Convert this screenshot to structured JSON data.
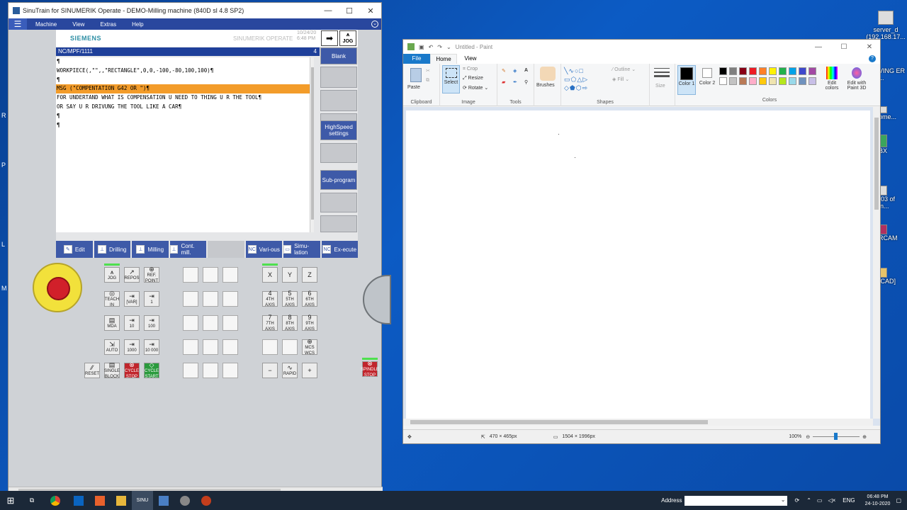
{
  "sinutrain": {
    "title": "SinuTrain for SINUMERIK Operate - DEMO-Milling machine (840D sl 4.8 SP2)",
    "menu": [
      "Machine",
      "View",
      "Extras",
      "Help"
    ],
    "brand": "SIEMENS",
    "product": "SINUMERIK OPERATE",
    "date": "10/24/20",
    "time": "6:48 PM",
    "jog_label": "JOG",
    "program_path": "NC/MPF/1111",
    "channel_num": "4",
    "lines": [
      "¶",
      "WORKPIECE(,\"\",,\"RECTANGLE\",0,0,-100,-80,100,100)¶",
      "¶",
      "MSG (\"COMPENTATION G42 OR \")¶",
      "FOR UNDERTAND WHAT IS COMPENSATION U NEED TO THING U R THE TOOL¶",
      "OR SAY U R DRIVUNG THE TOOL LIKE A CAR¶",
      "¶",
      "¶"
    ],
    "highlight_line": 3,
    "vsoftkeys": [
      "Blank",
      "",
      "",
      "",
      "HighSpeed settings",
      "",
      "Sub-program",
      "",
      ""
    ],
    "hsoftkeys": [
      {
        "label": "Edit",
        "icon": "edit-icon"
      },
      {
        "label": "Drilling",
        "icon": "drill-icon"
      },
      {
        "label": "Milling",
        "icon": "mill-icon"
      },
      {
        "label": "Cont. mill.",
        "icon": "contour-icon"
      },
      {
        "label": "",
        "icon": ""
      },
      {
        "label": "Vari-ous",
        "icon": "nc-icon"
      },
      {
        "label": "Simu-lation",
        "icon": "sim-icon"
      },
      {
        "label": "Ex-ecute",
        "icon": "nc-exec-icon"
      }
    ],
    "panel_keys": {
      "jog": "JOG",
      "repos": "REPOS",
      "refpoint": "REF. POINT",
      "teachin": "TEACH IN",
      "var": "[VAR]",
      "inc1": "1",
      "mda": "MDA",
      "inc10": "10",
      "inc100": "100",
      "auto": "AUTO",
      "inc1000": "1000",
      "inc10000": "10 000",
      "reset": "RESET",
      "single": "SINGLE BLOCK",
      "cstop": "CYCLE STOP",
      "cstart": "CYCLE START",
      "x": "X",
      "y": "Y",
      "z": "Z",
      "ax4": "4",
      "ax4s": "4TH AXIS",
      "ax5": "5",
      "ax5s": "5TH AXIS",
      "ax6": "6",
      "ax6s": "6TH AXIS",
      "ax7": "7",
      "ax7s": "7TH AXIS",
      "ax8": "8",
      "ax8s": "8TH AXIS",
      "ax9": "9",
      "ax9s": "9TH AXIS",
      "mcs": "MCS WCS",
      "minus": "−",
      "rapid": "RAPID",
      "plus": "+",
      "sstop": "SPINDLE STOP"
    }
  },
  "paint": {
    "title": "Untitled - Paint",
    "tabs": [
      "File",
      "Home",
      "View"
    ],
    "clipboard": {
      "paste": "Paste",
      "label": "Clipboard"
    },
    "image": {
      "select": "Select",
      "crop": "Crop",
      "resize": "Resize",
      "rotate": "Rotate",
      "label": "Image"
    },
    "tools_label": "Tools",
    "brushes": "Brushes",
    "shapes": {
      "outline": "Outline",
      "fill": "Fill",
      "label": "Shapes"
    },
    "size": "Size",
    "color1": "Color 1",
    "color2": "Color 2",
    "colors_label": "Colors",
    "edit_colors": "Edit colors",
    "paint3d": "Edit with Paint 3D",
    "palette": [
      "#000000",
      "#7f7f7f",
      "#880015",
      "#ed1c24",
      "#ff7f27",
      "#fff200",
      "#22b14c",
      "#00a2e8",
      "#3f48cc",
      "#a349a4",
      "#ffffff",
      "#c3c3c3",
      "#b97a57",
      "#ffaec9",
      "#ffc90e",
      "#efe4b0",
      "#b5e61d",
      "#99d9ea",
      "#7092be",
      "#c8bfe7"
    ],
    "cursor_pos": "470 × 465px",
    "canvas_size": "1504 × 1996px",
    "zoom": "100%"
  },
  "desktop": {
    "icons": [
      {
        "label": "server_d (192.168.17..."
      },
      {
        "label": "VING ER ..."
      },
      {
        "label": "ome..."
      },
      {
        "label": "BX"
      },
      {
        "label": "-03 of in..."
      },
      {
        "label": "RCAM"
      },
      {
        "label": "[CAD]"
      }
    ]
  },
  "taskbar": {
    "address_label": "Address",
    "lang": "ENG",
    "time": "06:48 PM",
    "date": "24-10-2020",
    "sinu_label": "SINU"
  }
}
